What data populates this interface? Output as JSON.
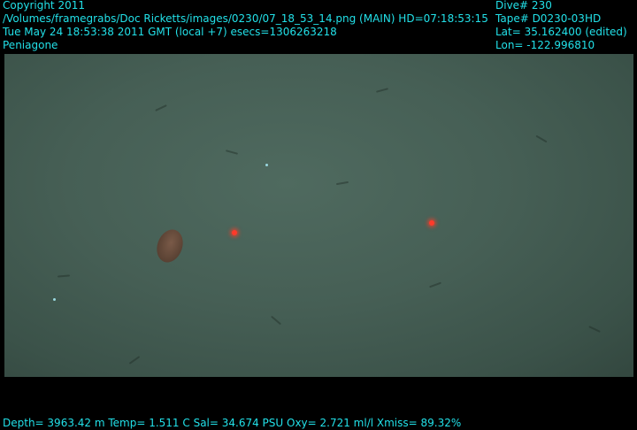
{
  "header_left": {
    "copyright": "Copyright 2011",
    "path": "/Volumes/framegrabs/Doc Ricketts/images/0230/07_18_53_14.png (MAIN)  HD=07:18:53:15",
    "datetime": "Tue May 24 18:53:38 2011 GMT (local +7)  esecs=1306263218",
    "label": "Peniagone"
  },
  "header_right": {
    "dive": "Dive# 230",
    "tape": "Tape# D0230-03HD",
    "lat": "Lat= 35.162400 (edited)",
    "lon": "Lon= -122.996810"
  },
  "footer": {
    "readout": "Depth= 3963.42 m  Temp= 1.511 C  Sal= 34.674 PSU  Oxy= 2.721 ml/l  Xmiss= 89.32%"
  },
  "colors": {
    "overlay_text": "#22e0e8",
    "background": "#000000",
    "laser": "#ff3a2a"
  }
}
